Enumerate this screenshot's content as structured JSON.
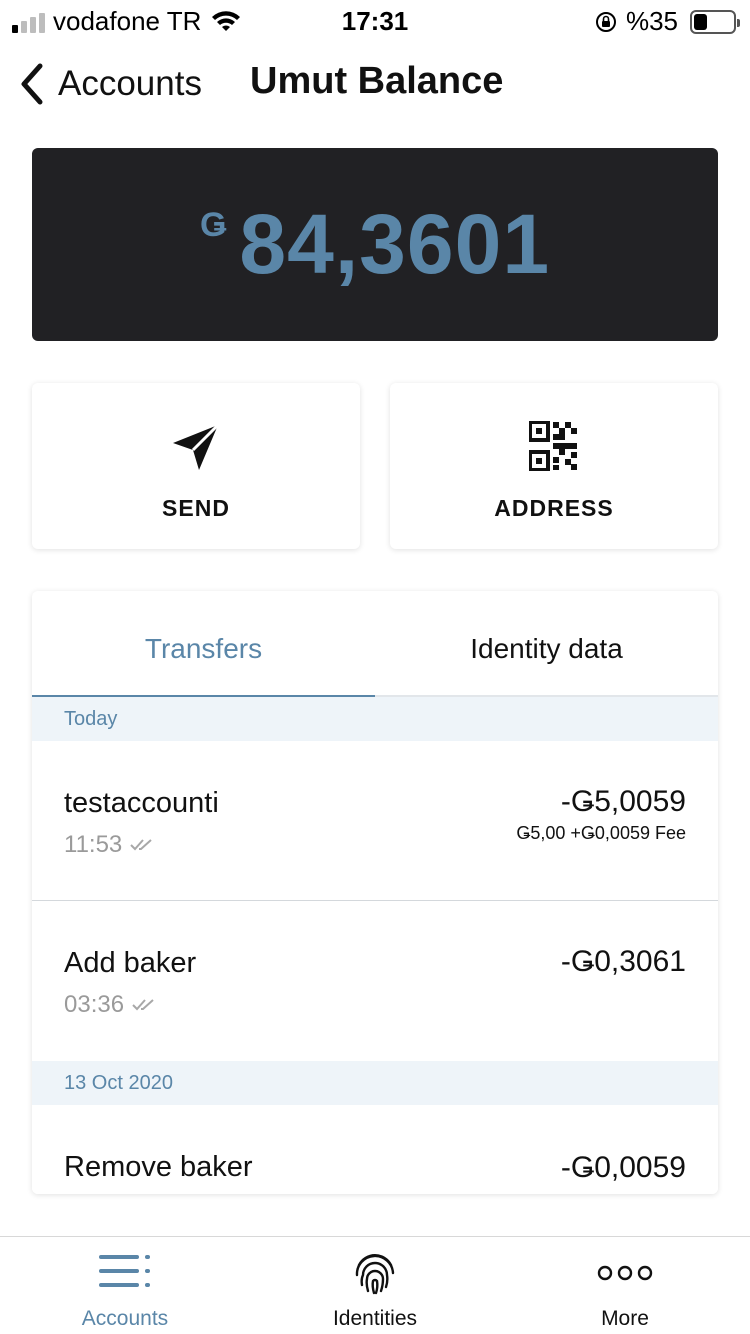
{
  "status_bar": {
    "carrier": "vodafone TR",
    "time": "17:31",
    "battery_text": "%35",
    "battery_level": 0.35
  },
  "nav": {
    "back_label": "Accounts",
    "title": "Umut Balance"
  },
  "balance": {
    "currency_symbol": "Ǥ",
    "amount": "84,3601"
  },
  "actions": {
    "send_label": "SEND",
    "address_label": "ADDRESS"
  },
  "tabs": {
    "transfers": "Transfers",
    "identity_data": "Identity data"
  },
  "sections": [
    {
      "header": "Today",
      "transactions": [
        {
          "name": "testaccounti",
          "time": "11:53",
          "amount": "-Ǥ5,0059",
          "fee": "Ǥ5,00 +Ǥ0,0059 Fee"
        },
        {
          "name": "Add baker",
          "time": "03:36",
          "amount": "-Ǥ0,3061"
        }
      ]
    },
    {
      "header": "13 Oct 2020",
      "transactions": [
        {
          "name": "Remove baker",
          "amount": "-Ǥ0,0059"
        }
      ]
    }
  ],
  "tab_bar": {
    "accounts": "Accounts",
    "identities": "Identities",
    "more": "More"
  },
  "colors": {
    "accent": "#5a86a8",
    "balance_card_bg": "#212124",
    "section_header_bg": "#eef4f9"
  }
}
